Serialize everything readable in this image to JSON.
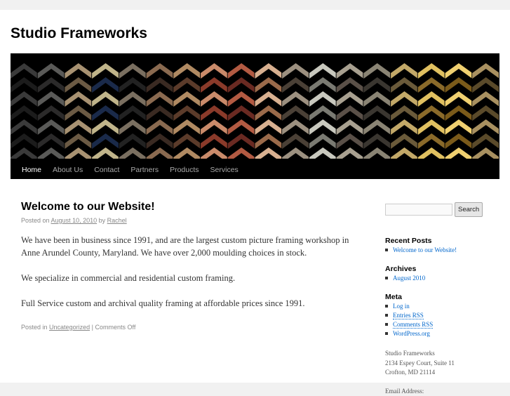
{
  "site": {
    "title": "Studio Frameworks"
  },
  "nav": {
    "items": [
      {
        "label": "Home",
        "current": true
      },
      {
        "label": "About Us",
        "current": false
      },
      {
        "label": "Contact",
        "current": false
      },
      {
        "label": "Partners",
        "current": false
      },
      {
        "label": "Products",
        "current": false
      },
      {
        "label": "Services",
        "current": false
      }
    ]
  },
  "post": {
    "title": "Welcome to our Website!",
    "meta_posted_on": "Posted on",
    "date": "August 10, 2010",
    "meta_by": "by",
    "author": "Rachel",
    "paragraphs": [
      "We have been in business since 1991, and are the largest custom picture framing workshop in Anne Arundel County, Maryland. We have over 2,000 moulding choices in stock.",
      "We specialize in commercial and residential custom framing.",
      "Full Service custom and archival quality framing at affordable prices since 1991."
    ],
    "posted_in": "Posted in",
    "category": "Uncategorized",
    "separator": "|",
    "comments": "Comments Off"
  },
  "sidebar": {
    "search": {
      "placeholder": "",
      "button_label": "Search"
    },
    "recent_posts": {
      "title": "Recent Posts",
      "items": [
        "Welcome to our Website!"
      ]
    },
    "archives": {
      "title": "Archives",
      "items": [
        "August 2010"
      ]
    },
    "meta": {
      "title": "Meta",
      "items": [
        "Log in",
        "Entries RSS",
        "Comments RSS",
        "WordPress.org"
      ]
    },
    "address": {
      "name": "Studio Frameworks",
      "street": "2134 Espey Court, Suite 11",
      "city": "Crofton, MD 21114"
    },
    "email_label": "Email Address:"
  },
  "colors": {
    "link": "#0066cc",
    "nav_background": "#000000",
    "page_background": "#f1f1f1"
  }
}
